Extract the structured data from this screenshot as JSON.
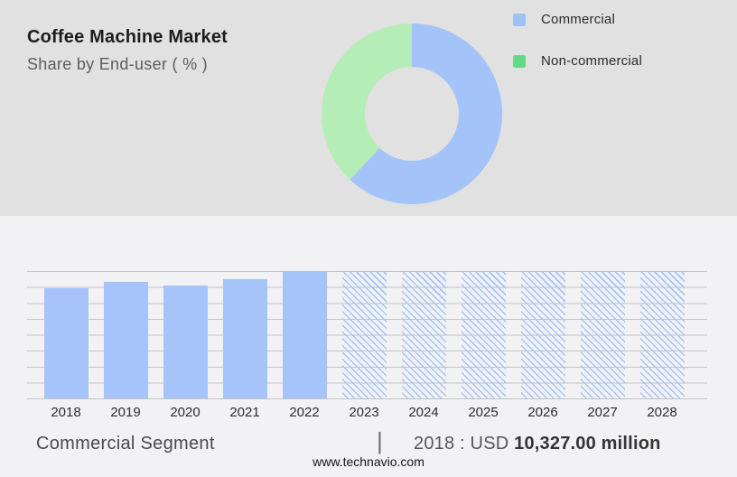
{
  "colors": {
    "page_bg": "#f2f2f4",
    "header_bg": "#e1e1e1",
    "bar_blue": "#a6c4f9",
    "hatch_blue": "#a3c5f7",
    "donut_blue": "#a4c3f9",
    "donut_green": "#b5edb6",
    "legend_blue": "#9dc1f8",
    "legend_green": "#62db85",
    "gridline": "#c4c4c4"
  },
  "header": {
    "title": "Coffee Machine Market",
    "subtitle": "Share by End-user ( % )"
  },
  "legend": {
    "items": [
      {
        "label": "Commercial",
        "color": "#9dc1f8"
      },
      {
        "label": "Non-commercial",
        "color": "#62db85"
      }
    ]
  },
  "donut": {
    "segments": [
      {
        "label": "Commercial",
        "pct": 62,
        "color": "#a4c3f9"
      },
      {
        "label": "Non-commercial",
        "pct": 38,
        "color": "#b5edb6"
      }
    ]
  },
  "bar_chart": {
    "years": [
      "2018",
      "2019",
      "2020",
      "2021",
      "2022",
      "2023",
      "2024",
      "2025",
      "2026",
      "2027",
      "2028"
    ],
    "bar_height_pct": [
      86.5,
      91.5,
      88.7,
      93.6,
      100,
      100,
      100,
      100,
      100,
      100,
      100
    ],
    "hatched": [
      false,
      false,
      false,
      false,
      false,
      true,
      true,
      true,
      true,
      true,
      true
    ]
  },
  "caption": {
    "segment_label": "Commercial Segment",
    "separator": "|",
    "value_prefix": "2018 : USD ",
    "value_bold": "10,327.00 million"
  },
  "footer": {
    "url": "www.technavio.com"
  },
  "chart_data": [
    {
      "type": "pie",
      "subtype": "donut",
      "title": "Coffee Machine Market",
      "subtitle": "Share by End-user ( % )",
      "labels": [
        "Commercial",
        "Non-commercial"
      ],
      "values": [
        62,
        38
      ],
      "colors": [
        "#a4c3f9",
        "#b5edb6"
      ],
      "legend_position": "right",
      "start_angle": "12 o'clock, clockwise",
      "note": "No numeric labels printed on chart; percentages estimated from arc angles (~223deg blue / ~137deg green)."
    },
    {
      "type": "bar",
      "title": "Commercial Segment",
      "categories": [
        "2018",
        "2019",
        "2020",
        "2021",
        "2022",
        "2023",
        "2024",
        "2025",
        "2026",
        "2027",
        "2028"
      ],
      "values_relative_pct_of_max": [
        86.5,
        91.5,
        88.7,
        93.6,
        100,
        100,
        100,
        100,
        100,
        100,
        100
      ],
      "labeled_value": {
        "year": "2018",
        "value": "USD 10,327.00 million"
      },
      "estimated_values_usd_million": [
        10327,
        10920,
        10580,
        11170,
        11940,
        null,
        null,
        null,
        null,
        null,
        null
      ],
      "solid_categories": [
        "2018",
        "2019",
        "2020",
        "2021",
        "2022"
      ],
      "hatched_forecast_categories": [
        "2023",
        "2024",
        "2025",
        "2026",
        "2027",
        "2028"
      ],
      "xlabel": "",
      "ylabel": "",
      "y_axis_ticks": "none (9 unlabeled horizontal gridlines)",
      "grid": true,
      "legend_position": "none"
    }
  ]
}
